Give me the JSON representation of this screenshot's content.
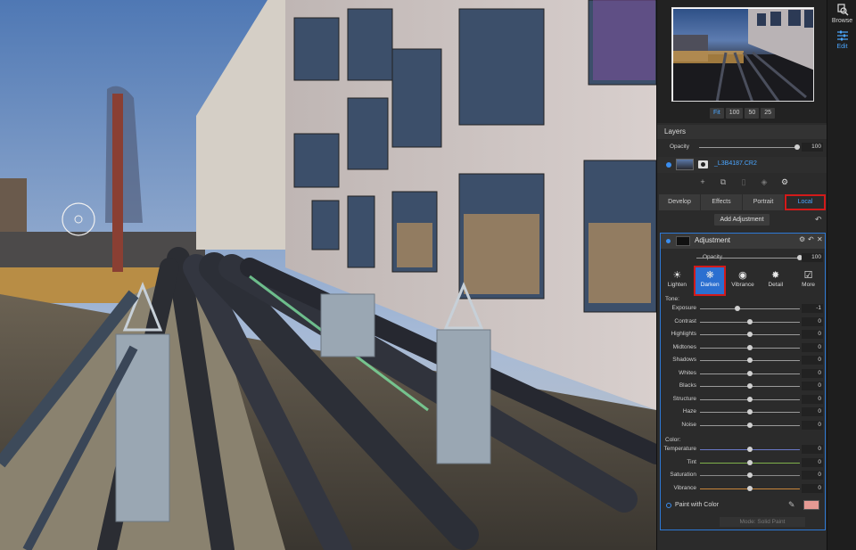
{
  "app": {
    "modes": [
      {
        "label": "Browse",
        "icon": "browse-icon"
      },
      {
        "label": "Edit",
        "icon": "edit-sliders-icon"
      }
    ]
  },
  "navigator": {
    "zoom_options": [
      "Fit",
      "100",
      "50",
      "25"
    ],
    "active_zoom": "Fit"
  },
  "layers": {
    "title": "Layers",
    "opacity_label": "Opacity",
    "opacity_value": "100",
    "opacity_level": 1.0,
    "layer_name": "_L3B4187.CR2"
  },
  "tabs": [
    {
      "label": "Develop",
      "active": false
    },
    {
      "label": "Effects",
      "active": false
    },
    {
      "label": "Portrait",
      "active": false
    },
    {
      "label": "Local",
      "active": true
    }
  ],
  "add_adjustment_label": "Add Adjustment",
  "adjustment": {
    "title": "Adjustment",
    "opacity_label": "Opacity",
    "opacity_value": "100",
    "opacity_level": 1.0,
    "presets": [
      {
        "label": "Lighten",
        "glyph": "☀",
        "icon": "lighten-icon",
        "active": false
      },
      {
        "label": "Darken",
        "glyph": "❋",
        "icon": "darken-icon",
        "active": true
      },
      {
        "label": "Vibrance",
        "glyph": "◉",
        "icon": "vibrance-icon",
        "active": false
      },
      {
        "label": "Detail",
        "glyph": "✸",
        "icon": "detail-icon",
        "active": false
      },
      {
        "label": "More",
        "glyph": "☑",
        "icon": "more-icon",
        "active": false
      }
    ],
    "tone_label": "Tone:",
    "tone": [
      {
        "label": "Exposure",
        "value": "-1",
        "level": -0.25
      },
      {
        "label": "Contrast",
        "value": "0",
        "level": 0
      },
      {
        "label": "Highlights",
        "value": "0",
        "level": 0
      },
      {
        "label": "Midtones",
        "value": "0",
        "level": 0
      },
      {
        "label": "Shadows",
        "value": "0",
        "level": 0
      },
      {
        "label": "Whites",
        "value": "0",
        "level": 0
      },
      {
        "label": "Blacks",
        "value": "0",
        "level": 0
      },
      {
        "label": "Structure",
        "value": "0",
        "level": 0
      },
      {
        "label": "Haze",
        "value": "0",
        "level": 0
      },
      {
        "label": "Noise",
        "value": "0",
        "level": 0
      }
    ],
    "color_label": "Color:",
    "color": [
      {
        "label": "Temperature",
        "value": "0",
        "level": 0,
        "track": "#6a78c8"
      },
      {
        "label": "Tint",
        "value": "0",
        "level": 0,
        "track": "#7fb14b"
      },
      {
        "label": "Saturation",
        "value": "0",
        "level": 0,
        "track": "#8a8a8a"
      },
      {
        "label": "Vibrance",
        "value": "0",
        "level": 0,
        "track": "#c8853a"
      }
    ],
    "paint_with_color_label": "Paint with Color",
    "paint_color": "#e59a94",
    "mode_text": "Mode: Solid Paint"
  },
  "colors": {
    "accent": "#4ba6ff",
    "highlight_box": "#d21a1a",
    "active_preset": "#2b6fd0"
  }
}
